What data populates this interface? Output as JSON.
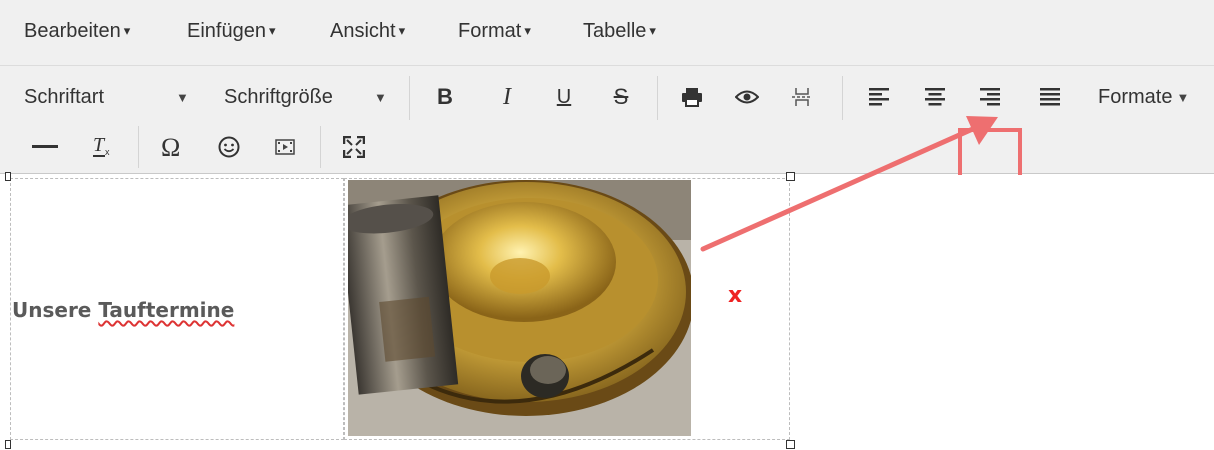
{
  "menubar": {
    "items": [
      "Bearbeiten",
      "Einfügen",
      "Ansicht",
      "Format",
      "Tabelle"
    ]
  },
  "toolbar": {
    "font_family": "Schriftart",
    "font_size": "Schriftgröße",
    "bold": "B",
    "italic": "I",
    "underline": "U",
    "strikethrough": "S",
    "formats": "Formate"
  },
  "content": {
    "heading": "Unsere",
    "heading_misspelled": "Tauftermine",
    "marker": "x"
  },
  "colors": {
    "highlight": "#ee6f70",
    "marker": "#e22222"
  },
  "icons": [
    "print-icon",
    "preview-icon",
    "page-break-icon",
    "align-left-icon",
    "align-center-icon",
    "align-right-icon",
    "align-justify-icon",
    "horizontal-rule-icon",
    "clear-formatting-icon",
    "special-character-icon",
    "emoticon-icon",
    "media-icon",
    "fullscreen-icon"
  ]
}
